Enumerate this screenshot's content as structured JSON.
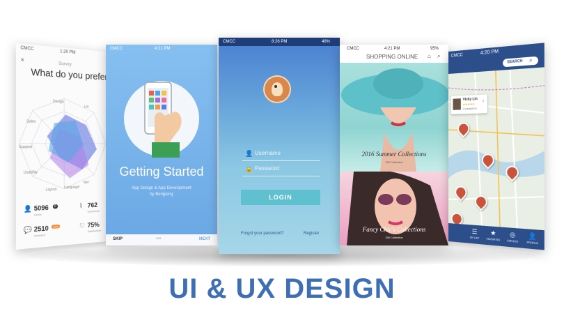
{
  "title": "UI & UX DESIGN",
  "colors": {
    "title": "#3e6fb5",
    "login_btn": "#5fc0cf",
    "map_nav": "#2c4f8c",
    "pin": "#c9543c"
  },
  "survey": {
    "carrier": "CMCC",
    "time": "1:20 PM",
    "heading_small": "Survey",
    "question": "What do you prefer ?",
    "axes": [
      "Design",
      "UX",
      "Support",
      "Sales",
      "Usability",
      "Layout",
      "Language",
      "Net"
    ],
    "stats": [
      {
        "icon": "user-icon",
        "value": "5096",
        "badge": "6",
        "label": "Users"
      },
      {
        "icon": "clip-icon",
        "value": "762",
        "label": "Questions"
      },
      {
        "icon": "chat-icon",
        "value": "2510",
        "badge": "12%",
        "label": "Answers"
      },
      {
        "icon": "heart-icon",
        "value": "75%",
        "label": "Satisfaction"
      }
    ]
  },
  "getting_started": {
    "carrier": "CMCC",
    "time": "4:21 PM",
    "title": "Getting Started",
    "subtitle_line1": "App Design & App Development",
    "subtitle_line2": "by Bengiang",
    "skip": "SKIP",
    "next": "NEXT"
  },
  "login": {
    "carrier": "CMCC",
    "time": "8:26 PM",
    "battery": "48%",
    "username_placeholder": "Username",
    "password_placeholder": "Password",
    "login_label": "LOGIN",
    "forgot": "Forgot your password?",
    "register": "Register"
  },
  "shop": {
    "carrier": "CMCC",
    "time": "4:21 PM",
    "battery": "95%",
    "title": "SHOPPING ONLINE",
    "collection1": "2016 Summer Collections",
    "collection1_sub": "150 Collection",
    "collection2": "Fancy Chic's Collections",
    "collection2_sub": "150 Collection"
  },
  "map": {
    "carrier": "CMCC",
    "time": "4:20 PM",
    "search_label": "SEARCH",
    "profile_name": "Vicky Lin",
    "profile_loc": "Guangzhou",
    "rating": "★★★★★",
    "nav": [
      {
        "icon": "list-icon",
        "glyph": "☰",
        "label": "MY LIST"
      },
      {
        "icon": "star-icon",
        "glyph": "★",
        "label": "FAVORITES"
      },
      {
        "icon": "circles-icon",
        "glyph": "◎",
        "label": "CIRCLES"
      },
      {
        "icon": "profile-icon",
        "glyph": "👤",
        "label": "PROFILE"
      }
    ]
  }
}
